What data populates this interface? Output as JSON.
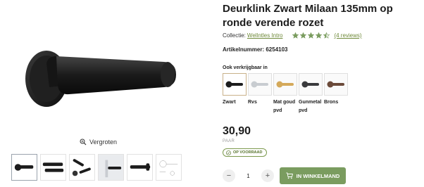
{
  "product": {
    "title": "Deurklink Zwart Milaan 135mm op ronde verende rozet",
    "collection_label": "Collectie:",
    "collection_name": "Wellntles Intro",
    "rating": 4.5,
    "reviews_label": "(4 reviews)",
    "article_label": "Artikelnummer:",
    "article_number": "6254103"
  },
  "gallery": {
    "zoom_label": "Vergroten",
    "zoom_icon": "magnifier-icon",
    "thumbnails": [
      "handle-black",
      "handle-pair",
      "handle-parts",
      "handle-on-door",
      "handle-side",
      "technical-drawing"
    ]
  },
  "variants": {
    "title": "Ook verkrijgbaar in",
    "items": [
      {
        "label": "Zwart",
        "color": "#1c1c1c"
      },
      {
        "label": "Rvs",
        "color": "#c8ccd0"
      },
      {
        "label": "Mat goud pvd",
        "color": "#d4a95a"
      },
      {
        "label": "Gunmetal pvd",
        "color": "#3a3b3d"
      },
      {
        "label": "Brons",
        "color": "#6b4a3a"
      }
    ]
  },
  "pricing": {
    "price": "30,90",
    "unit": "PAAR",
    "stock_label": "OP VOORRAAD"
  },
  "cart": {
    "quantity": "1",
    "minus": "−",
    "plus": "+",
    "button_label": "IN WINKELMAND"
  },
  "colors": {
    "accent_green": "#7a9c5f",
    "link_green": "#6f8a3a",
    "star": "#7a9c5f"
  }
}
